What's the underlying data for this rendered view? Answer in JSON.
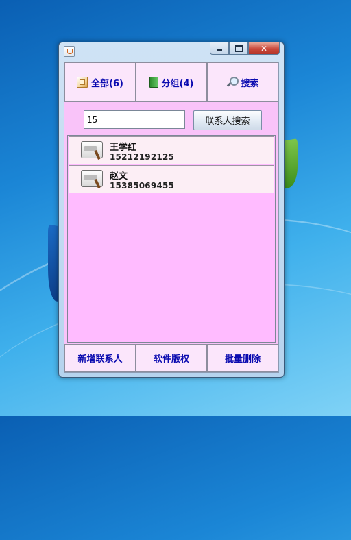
{
  "window": {
    "title": ""
  },
  "tabs": [
    {
      "label": "全部(6)",
      "icon": "address-book-icon"
    },
    {
      "label": "分组(4)",
      "icon": "green-book-icon"
    },
    {
      "label": "搜索",
      "icon": "magnifier-icon"
    }
  ],
  "search": {
    "value": "15",
    "button_label": "联系人搜索"
  },
  "contacts": [
    {
      "name": "王学红",
      "phone": "15212192125"
    },
    {
      "name": "赵文",
      "phone": "15385069455"
    }
  ],
  "bottom_buttons": [
    {
      "label": "新增联系人"
    },
    {
      "label": "软件版权"
    },
    {
      "label": "批量删除"
    }
  ],
  "colors": {
    "panel_bg": "#f9c3f9",
    "list_bg": "#ffbbff",
    "tab_text": "#0b0bb0",
    "contact_bg": "#fceef5"
  }
}
